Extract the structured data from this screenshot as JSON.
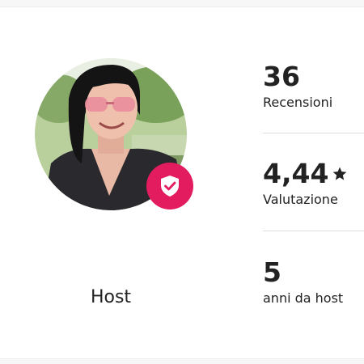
{
  "profile": {
    "role": "Host",
    "avatar_icon": "profile-photo",
    "badge_icon": "verified-shield-icon",
    "accent_color": "#e31c5f"
  },
  "stats": {
    "reviews": {
      "value": "36",
      "label": "Recensioni"
    },
    "rating": {
      "value": "4,44",
      "label": "Valutazione",
      "icon": "star-icon"
    },
    "years": {
      "value": "5",
      "label": "anni da host"
    }
  }
}
